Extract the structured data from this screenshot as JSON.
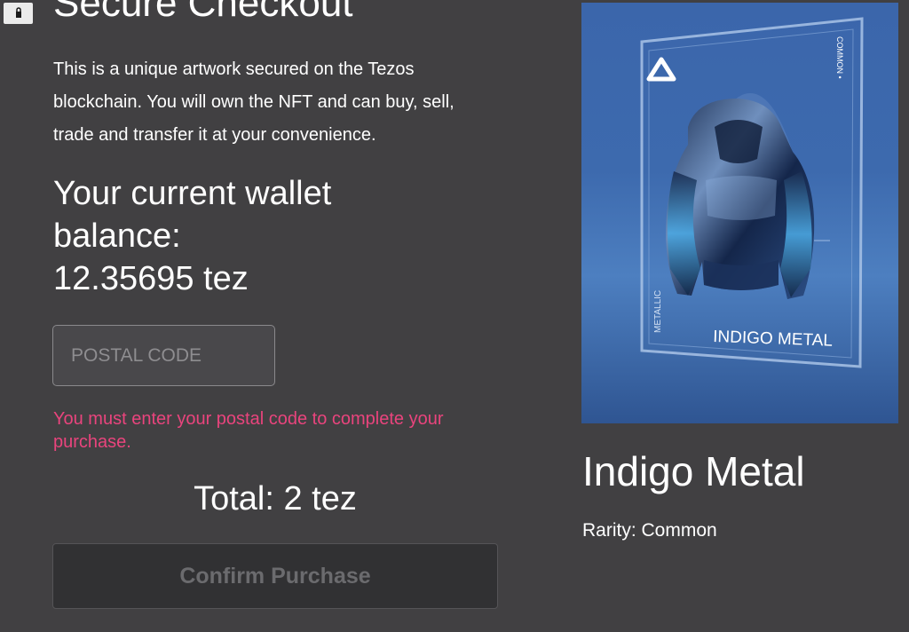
{
  "checkout": {
    "title": "Secure Checkout",
    "description": "This is a unique artwork secured on the Tezos blockchain. You will own the NFT and can buy, sell, trade and transfer it at your convenience.",
    "wallet_heading": "Your current wallet balance:",
    "wallet_balance": "12.35695 tez",
    "postal_code_placeholder": "POSTAL CODE",
    "postal_code_value": "",
    "error_message": "You must enter your postal code to complete your purchase.",
    "total": "Total: 2 tez",
    "confirm_label": "Confirm Purchase"
  },
  "item": {
    "card_side_top": "COMMON •",
    "card_side_bottom": "METALLIC",
    "card_label": "INDIGO METAL",
    "name": "Indigo Metal",
    "rarity": "Rarity: Common"
  },
  "colors": {
    "background": "#414042",
    "error": "#e9447d",
    "artwork_blue": "#3d6aae",
    "button_disabled_text": "#6b6b6e"
  },
  "icons": {
    "header": "lock-icon",
    "card": "delta-logo-icon"
  }
}
